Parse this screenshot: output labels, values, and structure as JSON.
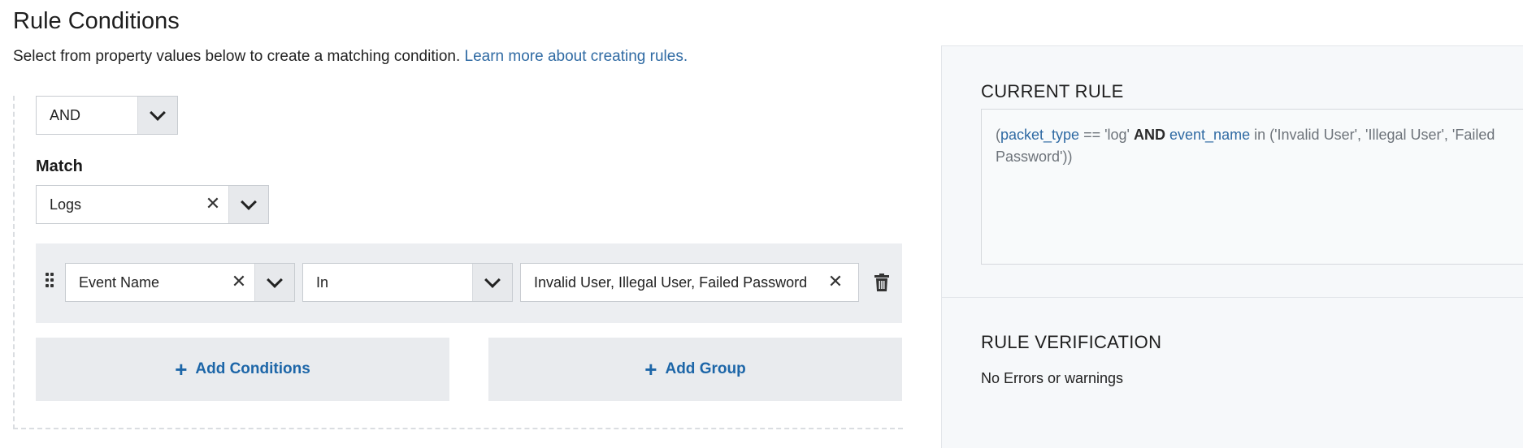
{
  "page": {
    "title": "Rule Conditions",
    "subtitle": "Select from property values below to create a matching condition.",
    "learn_more": "Learn more about creating rules."
  },
  "operator_select": {
    "value": "AND"
  },
  "match": {
    "label": "Match",
    "value": "Logs"
  },
  "condition": {
    "field": "Event Name",
    "operator": "In",
    "values": "Invalid User, Illegal User, Failed Password"
  },
  "buttons": {
    "add_conditions": "Add Conditions",
    "add_group": "Add Group"
  },
  "current_rule": {
    "title": "CURRENT RULE",
    "tokens": {
      "open": "(",
      "field1": "packet_type",
      "eq": " == 'log' ",
      "and": "AND",
      "sp": " ",
      "field2": "event_name",
      "rest": " in ('Invalid User', 'Illegal User', 'Failed Password'))"
    }
  },
  "verification": {
    "title": "RULE VERIFICATION",
    "message": "No Errors or warnings"
  },
  "colors": {
    "link": "#2f6aa3",
    "button_text": "#1d66a8",
    "panel_bg": "#f6f8fa"
  }
}
